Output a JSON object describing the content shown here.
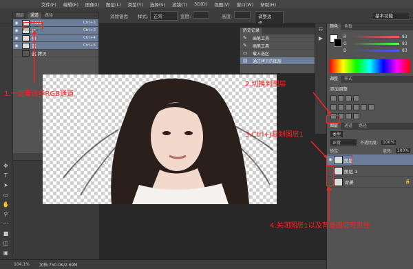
{
  "menu": [
    "文件(F)",
    "编辑(E)",
    "图像(I)",
    "图层(L)",
    "类型(Y)",
    "选择(S)",
    "滤镜(T)",
    "3D(D)",
    "视图(V)",
    "窗口(W)",
    "帮助(H)"
  ],
  "options": {
    "feather_label": "消除锯齿",
    "style_label": "样式:",
    "style_value": "正常",
    "width_label": "宽度:",
    "height_label": "高度:",
    "refine_label": "调整边缘...",
    "workspace": "基本功能"
  },
  "channels": {
    "tabs": [
      "图层",
      "通道",
      "路径"
    ],
    "rows": [
      {
        "name": "RGB",
        "key": "Ctrl+2",
        "selected": true
      },
      {
        "name": "红",
        "key": "Ctrl+3",
        "selected": true
      },
      {
        "name": "绿",
        "key": "Ctrl+4",
        "selected": true
      },
      {
        "name": "蓝",
        "key": "Ctrl+5",
        "selected": true
      },
      {
        "name": "蓝 拷贝",
        "key": "",
        "selected": false
      }
    ]
  },
  "history": {
    "title": "历史记录",
    "rows": [
      {
        "name": "画笔工具",
        "selected": false
      },
      {
        "name": "画笔工具",
        "selected": false
      },
      {
        "name": "载入选区",
        "selected": false
      },
      {
        "name": "通过拷贝的图层",
        "selected": true
      }
    ]
  },
  "color_panel": {
    "tabs": [
      "颜色",
      "色板"
    ],
    "r": "R",
    "g": "G",
    "b": "B",
    "r_val": "83",
    "g_val": "83",
    "b_val": "83"
  },
  "adjust_panel": {
    "tabs": [
      "调整",
      "样式"
    ],
    "title": "添加调整"
  },
  "layers_panel": {
    "tabs": [
      "图层",
      "通道",
      "路径"
    ],
    "kind": "类型",
    "mode": "正常",
    "opacity_label": "不透明度:",
    "opacity": "100%",
    "lock_label": "锁定:",
    "fill_label": "填充:",
    "fill": "100%",
    "layers": [
      {
        "name": "图层",
        "selected": true,
        "visible": true
      },
      {
        "name": "图层 1",
        "selected": false,
        "visible": false
      },
      {
        "name": "背景",
        "selected": false,
        "visible": false
      }
    ]
  },
  "status": {
    "zoom": "104.1%",
    "doc": "文档:750.0K/2.69M"
  },
  "annotations": {
    "a1": "1.一定要选择RGB通道",
    "a2": "2.切换到图层",
    "a3": "3.Ctrl+J复制图层1",
    "a4": "4.关闭图层1以及背景图层可见性"
  },
  "colors": {
    "annotation": "#ff2020",
    "selection": "#6b7d99"
  }
}
